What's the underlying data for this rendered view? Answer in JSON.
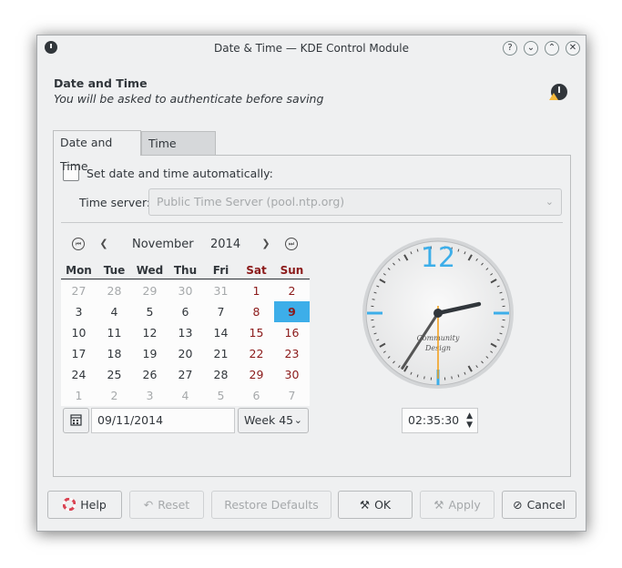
{
  "window": {
    "title": "Date & Time — KDE Control Module"
  },
  "window_buttons": {
    "help": "?",
    "minimize": "⌄",
    "maximize": "⌃",
    "close": "✕"
  },
  "header": {
    "title": "Date and Time",
    "subtitle": "You will be asked to authenticate before saving"
  },
  "tabs": [
    {
      "label": "Date and Time",
      "active": true
    },
    {
      "label": "Time Zone",
      "active": false
    }
  ],
  "auto": {
    "label": "Set date and time automatically:",
    "checked": false
  },
  "server": {
    "label": "Time server:",
    "value": "Public Time Server (pool.ntp.org)"
  },
  "calendar": {
    "month": "November",
    "year": "2014",
    "days": [
      "Mon",
      "Tue",
      "Wed",
      "Thu",
      "Fri",
      "Sat",
      "Sun"
    ],
    "weeks": [
      [
        "27",
        "28",
        "29",
        "30",
        "31",
        "1",
        "2"
      ],
      [
        "3",
        "4",
        "5",
        "6",
        "7",
        "8",
        "9"
      ],
      [
        "10",
        "11",
        "12",
        "13",
        "14",
        "15",
        "16"
      ],
      [
        "17",
        "18",
        "19",
        "20",
        "21",
        "22",
        "23"
      ],
      [
        "24",
        "25",
        "26",
        "27",
        "28",
        "29",
        "30"
      ],
      [
        "1",
        "2",
        "3",
        "4",
        "5",
        "6",
        "7"
      ]
    ],
    "selected": "9"
  },
  "date_input": {
    "value": "09/11/2014"
  },
  "week_select": {
    "value": "Week 45"
  },
  "clock": {
    "hour_numeral": "12",
    "brand_line1": "Community",
    "brand_line2": "Design",
    "hours": 2,
    "minutes": 35,
    "seconds": 30
  },
  "time_input": {
    "value": "02:35:30"
  },
  "buttons": {
    "help": "Help",
    "reset": "Reset",
    "restore": "Restore Defaults",
    "ok": "OK",
    "apply": "Apply",
    "cancel": "Cancel"
  },
  "colors": {
    "accent": "#3daee9",
    "weekend": "#8b1a1a",
    "second_hand": "#f39c12"
  }
}
